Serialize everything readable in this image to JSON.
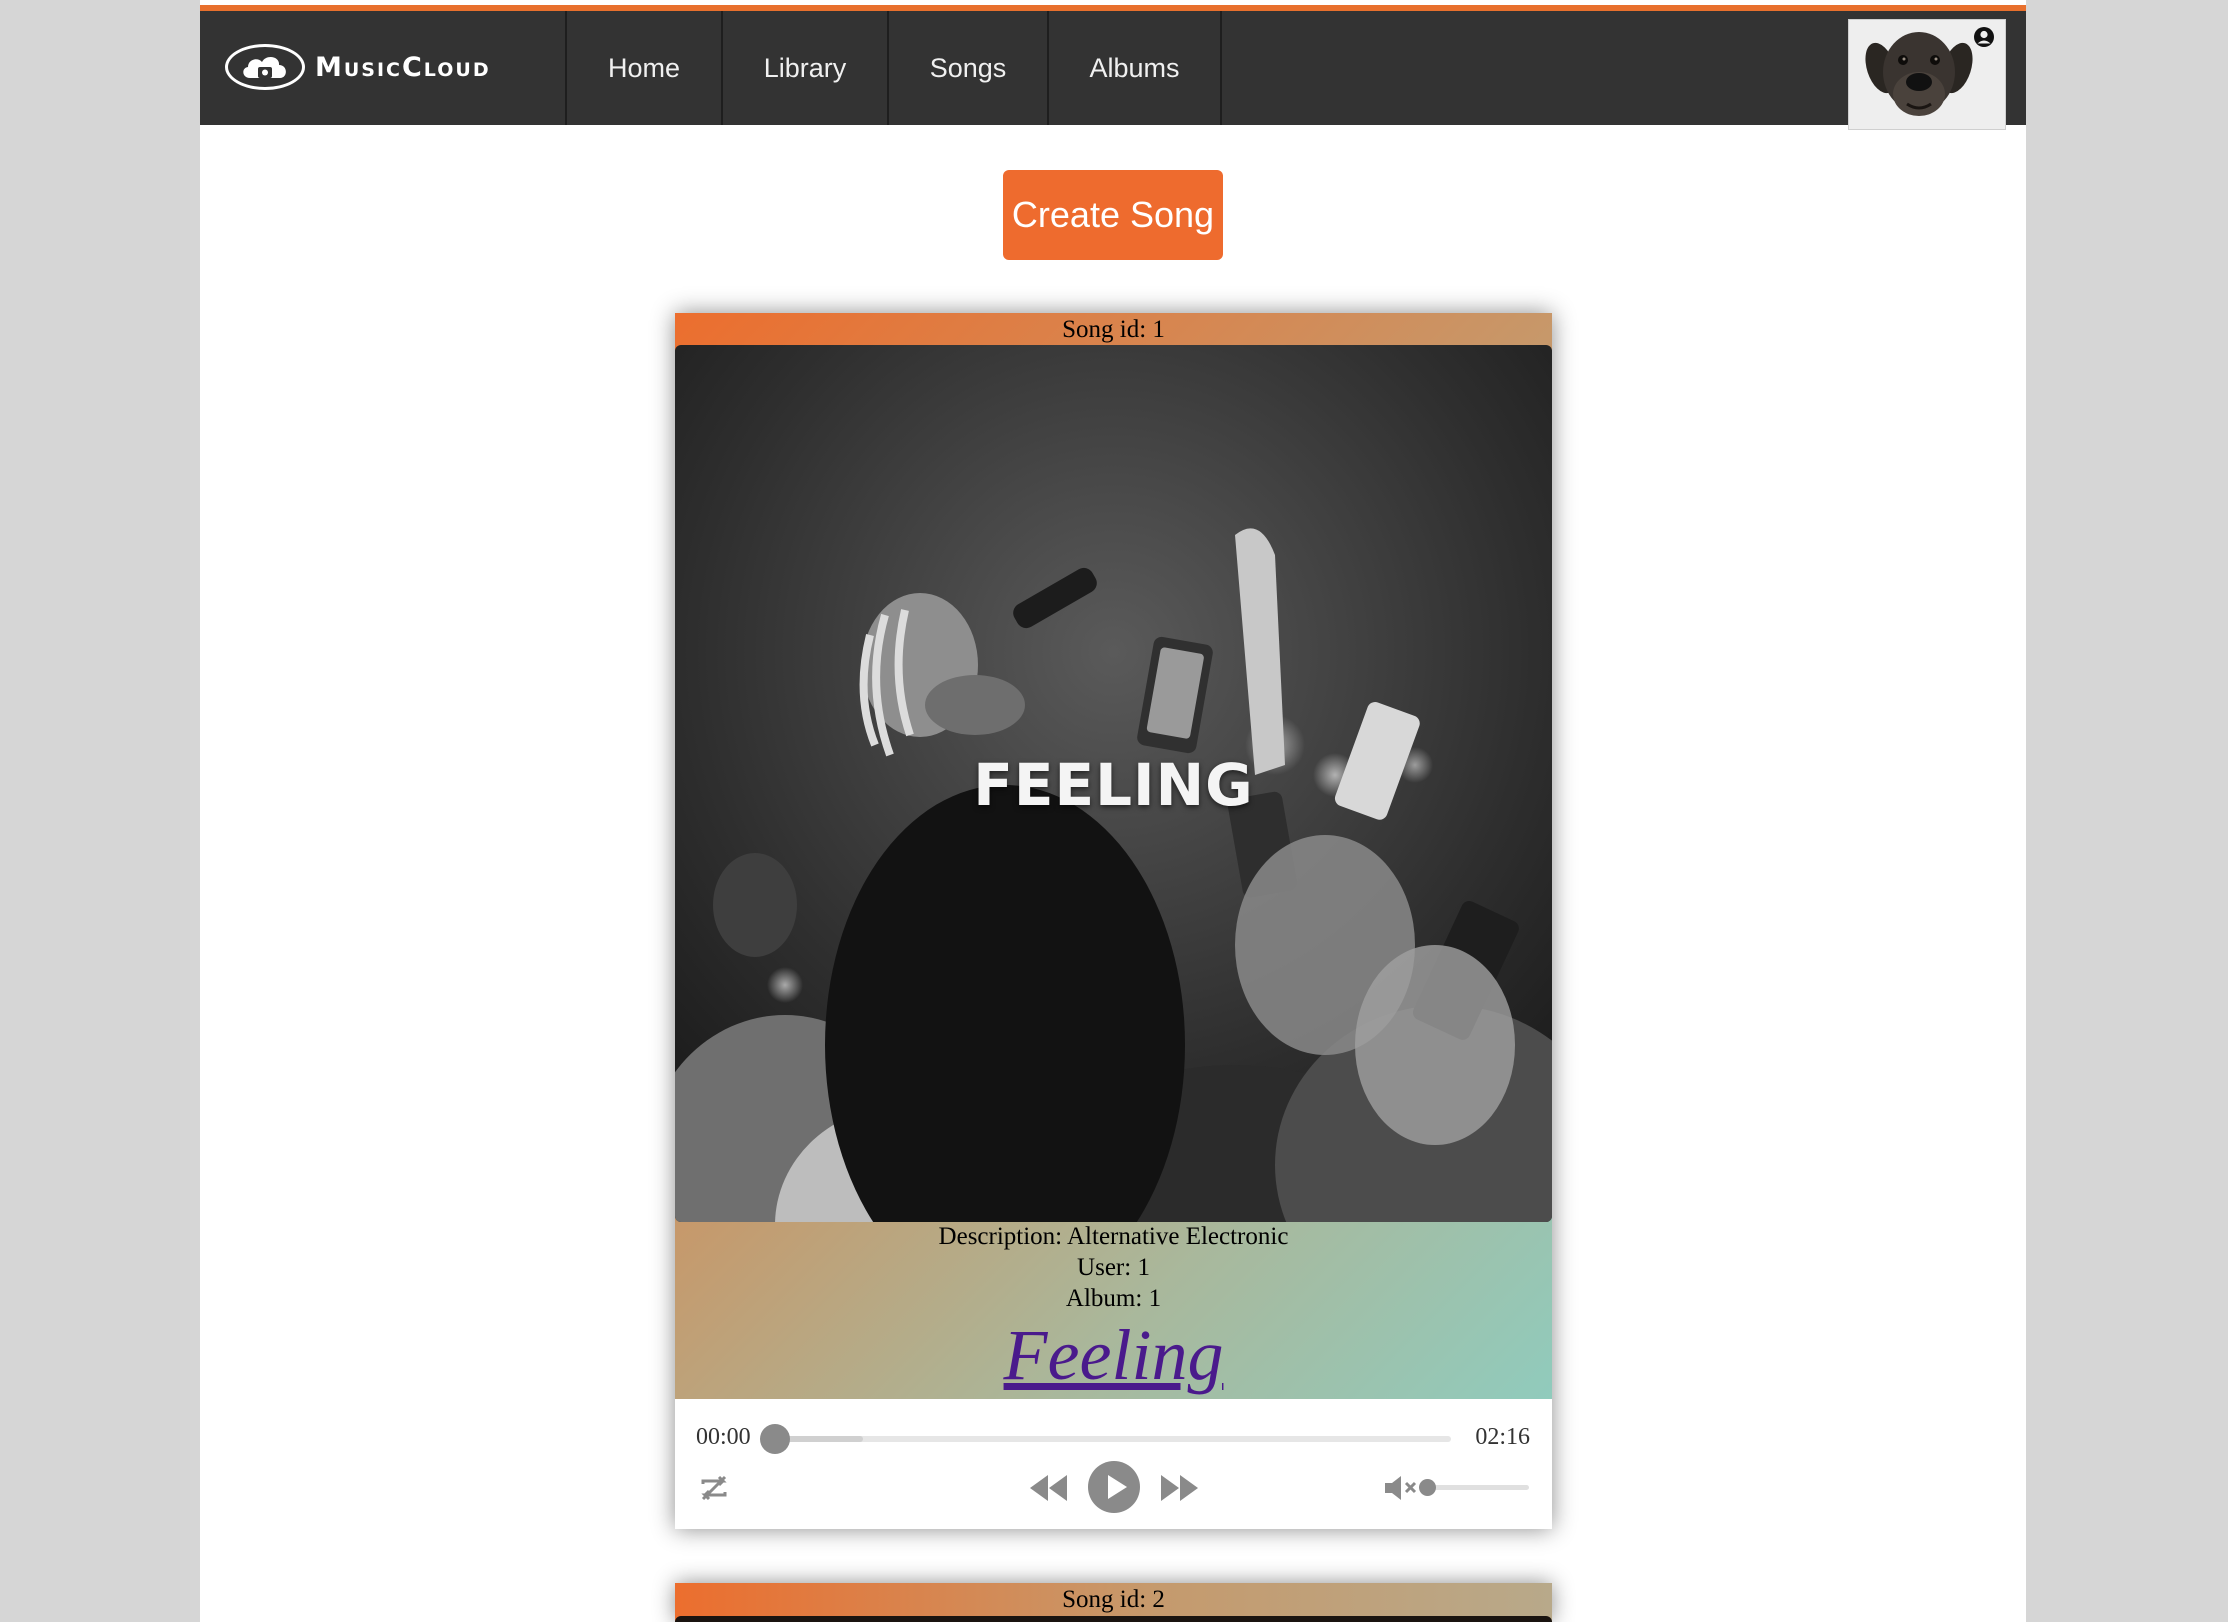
{
  "brand": {
    "name": "MusicCloud",
    "logo_icon": "cloud-phone-icon"
  },
  "nav": {
    "items": [
      {
        "label": "Home"
      },
      {
        "label": "Library"
      },
      {
        "label": "Songs"
      },
      {
        "label": "Albums"
      }
    ]
  },
  "user_menu": {
    "avatar": "dog-avatar",
    "icon": "user-circle-icon"
  },
  "actions": {
    "create_song_label": "Create Song"
  },
  "songs": [
    {
      "id_text": "Song id: 1",
      "cover_title": "FEELING",
      "description": "Description: Alternative Electronic",
      "user": "User: 1",
      "album": "Album: 1",
      "title": "Feeling",
      "player": {
        "current_time": "00:00",
        "duration": "02:16",
        "progress": 0.0,
        "buffered": 0.13,
        "volume": 0.0,
        "muted": true
      }
    },
    {
      "id_text": "Song id: 2"
    }
  ],
  "colors": {
    "accent": "#ee6b2e",
    "navbar": "#333333",
    "background": "#d6d6d6",
    "link": "#4a1a8c",
    "gradient_end": "#8ad0c5"
  }
}
